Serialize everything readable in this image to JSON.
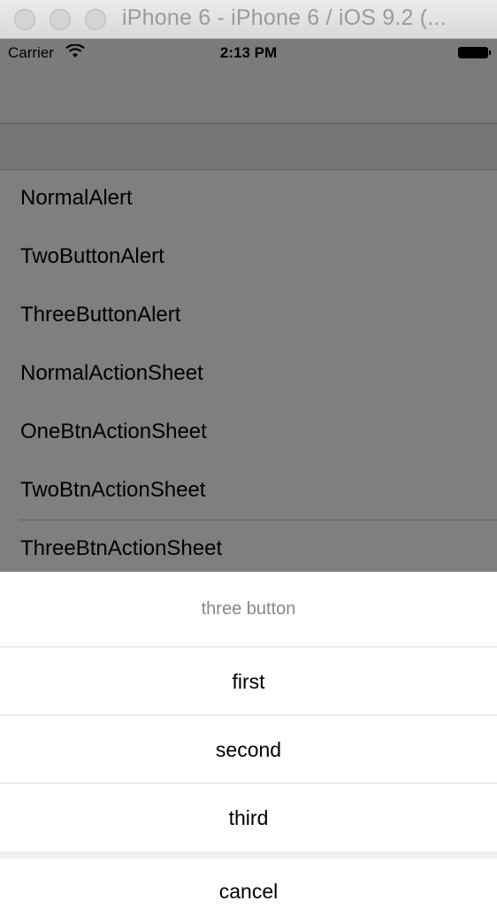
{
  "window": {
    "title": "iPhone 6 - iPhone 6 / iOS 9.2 (..."
  },
  "statusbar": {
    "carrier": "Carrier",
    "time": "2:13 PM"
  },
  "list": {
    "items": [
      {
        "label": "NormalAlert"
      },
      {
        "label": "TwoButtonAlert"
      },
      {
        "label": "ThreeButtonAlert"
      },
      {
        "label": "NormalActionSheet"
      },
      {
        "label": "OneBtnActionSheet"
      },
      {
        "label": "TwoBtnActionSheet"
      },
      {
        "label": "ThreeBtnActionSheet"
      }
    ]
  },
  "action_sheet": {
    "title": "three button",
    "buttons": [
      {
        "label": "first"
      },
      {
        "label": "second"
      },
      {
        "label": "third"
      }
    ],
    "cancel_label": "cancel"
  },
  "colors": {
    "overlay": "#000000",
    "sheet_background": "#efeff4",
    "title_text": "#888888"
  }
}
